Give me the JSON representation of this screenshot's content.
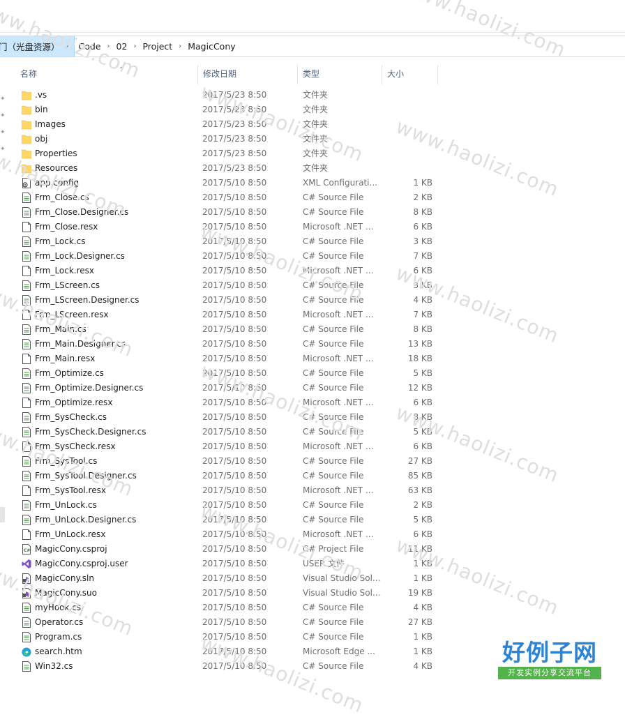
{
  "breadcrumb": [
    {
      "label": "门（光盘资源）"
    },
    {
      "label": "Code"
    },
    {
      "label": "02"
    },
    {
      "label": "Project"
    },
    {
      "label": "MagicCony"
    }
  ],
  "columns": {
    "name": "名称",
    "date": "修改日期",
    "type": "类型",
    "size": "大小"
  },
  "files": [
    {
      "name": ".vs",
      "date": "2017/5/23 8:50",
      "type": "文件夹",
      "size": "",
      "icon": "folder-icon"
    },
    {
      "name": "bin",
      "date": "2017/5/23 8:50",
      "type": "文件夹",
      "size": "",
      "icon": "folder-icon"
    },
    {
      "name": "Images",
      "date": "2017/5/23 8:50",
      "type": "文件夹",
      "size": "",
      "icon": "folder-icon"
    },
    {
      "name": "obj",
      "date": "2017/5/23 8:50",
      "type": "文件夹",
      "size": "",
      "icon": "folder-icon"
    },
    {
      "name": "Properties",
      "date": "2017/5/23 8:50",
      "type": "文件夹",
      "size": "",
      "icon": "folder-icon"
    },
    {
      "name": "Resources",
      "date": "2017/5/23 8:50",
      "type": "文件夹",
      "size": "",
      "icon": "folder-icon"
    },
    {
      "name": "app.config",
      "date": "2017/5/10 8:50",
      "type": "XML Configurati...",
      "size": "1 KB",
      "icon": "config-file-icon"
    },
    {
      "name": "Frm_Close.cs",
      "date": "2017/5/10 8:50",
      "type": "C# Source File",
      "size": "2 KB",
      "icon": "code-file-icon"
    },
    {
      "name": "Frm_Close.Designer.cs",
      "date": "2017/5/10 8:50",
      "type": "C# Source File",
      "size": "8 KB",
      "icon": "code-file-icon"
    },
    {
      "name": "Frm_Close.resx",
      "date": "2017/5/10 8:50",
      "type": "Microsoft .NET ...",
      "size": "6 KB",
      "icon": "blank-file-icon"
    },
    {
      "name": "Frm_Lock.cs",
      "date": "2017/5/10 8:50",
      "type": "C# Source File",
      "size": "3 KB",
      "icon": "code-file-icon"
    },
    {
      "name": "Frm_Lock.Designer.cs",
      "date": "2017/5/10 8:50",
      "type": "C# Source File",
      "size": "7 KB",
      "icon": "code-file-icon"
    },
    {
      "name": "Frm_Lock.resx",
      "date": "2017/5/10 8:50",
      "type": "Microsoft .NET ...",
      "size": "6 KB",
      "icon": "blank-file-icon"
    },
    {
      "name": "Frm_LScreen.cs",
      "date": "2017/5/10 8:50",
      "type": "C# Source File",
      "size": "3 KB",
      "icon": "code-file-icon"
    },
    {
      "name": "Frm_LScreen.Designer.cs",
      "date": "2017/5/10 8:50",
      "type": "C# Source File",
      "size": "4 KB",
      "icon": "code-file-icon"
    },
    {
      "name": "Frm_LScreen.resx",
      "date": "2017/5/10 8:50",
      "type": "Microsoft .NET ...",
      "size": "7 KB",
      "icon": "blank-file-icon"
    },
    {
      "name": "Frm_Main.cs",
      "date": "2017/5/10 8:50",
      "type": "C# Source File",
      "size": "8 KB",
      "icon": "code-file-icon"
    },
    {
      "name": "Frm_Main.Designer.cs",
      "date": "2017/5/10 8:50",
      "type": "C# Source File",
      "size": "13 KB",
      "icon": "code-file-icon"
    },
    {
      "name": "Frm_Main.resx",
      "date": "2017/5/10 8:50",
      "type": "Microsoft .NET ...",
      "size": "18 KB",
      "icon": "blank-file-icon"
    },
    {
      "name": "Frm_Optimize.cs",
      "date": "2017/5/10 8:50",
      "type": "C# Source File",
      "size": "5 KB",
      "icon": "code-file-icon"
    },
    {
      "name": "Frm_Optimize.Designer.cs",
      "date": "2017/5/10 8:50",
      "type": "C# Source File",
      "size": "12 KB",
      "icon": "code-file-icon"
    },
    {
      "name": "Frm_Optimize.resx",
      "date": "2017/5/10 8:50",
      "type": "Microsoft .NET ...",
      "size": "6 KB",
      "icon": "blank-file-icon"
    },
    {
      "name": "Frm_SysCheck.cs",
      "date": "2017/5/10 8:50",
      "type": "C# Source File",
      "size": "8 KB",
      "icon": "code-file-icon"
    },
    {
      "name": "Frm_SysCheck.Designer.cs",
      "date": "2017/5/10 8:50",
      "type": "C# Source File",
      "size": "5 KB",
      "icon": "code-file-icon"
    },
    {
      "name": "Frm_SysCheck.resx",
      "date": "2017/5/10 8:50",
      "type": "Microsoft .NET ...",
      "size": "6 KB",
      "icon": "blank-file-icon"
    },
    {
      "name": "Frm_SysTool.cs",
      "date": "2017/5/10 8:50",
      "type": "C# Source File",
      "size": "27 KB",
      "icon": "code-file-icon"
    },
    {
      "name": "Frm_SysTool.Designer.cs",
      "date": "2017/5/10 8:50",
      "type": "C# Source File",
      "size": "85 KB",
      "icon": "code-file-icon"
    },
    {
      "name": "Frm_SysTool.resx",
      "date": "2017/5/10 8:50",
      "type": "Microsoft .NET ...",
      "size": "63 KB",
      "icon": "blank-file-icon"
    },
    {
      "name": "Frm_UnLock.cs",
      "date": "2017/5/10 8:50",
      "type": "C# Source File",
      "size": "2 KB",
      "icon": "code-file-icon"
    },
    {
      "name": "Frm_UnLock.Designer.cs",
      "date": "2017/5/10 8:50",
      "type": "C# Source File",
      "size": "5 KB",
      "icon": "code-file-icon"
    },
    {
      "name": "Frm_UnLock.resx",
      "date": "2017/5/10 8:50",
      "type": "Microsoft .NET ...",
      "size": "6 KB",
      "icon": "blank-file-icon"
    },
    {
      "name": "MagicCony.csproj",
      "date": "2017/5/10 8:50",
      "type": "C# Project File",
      "size": "11 KB",
      "icon": "csproj-file-icon"
    },
    {
      "name": "MagicCony.csproj.user",
      "date": "2017/5/10 8:50",
      "type": "USER 文件",
      "size": "1 KB",
      "icon": "visual-studio-icon"
    },
    {
      "name": "MagicCony.sln",
      "date": "2017/5/10 8:50",
      "type": "Visual Studio Sol...",
      "size": "1 KB",
      "icon": "solution-file-icon"
    },
    {
      "name": "MagicCony.suo",
      "date": "2017/5/10 8:50",
      "type": "Visual Studio Sol...",
      "size": "19 KB",
      "icon": "solution-file-icon"
    },
    {
      "name": "myHook.cs",
      "date": "2017/5/10 8:50",
      "type": "C# Source File",
      "size": "4 KB",
      "icon": "code-file-icon"
    },
    {
      "name": "Operator.cs",
      "date": "2017/5/10 8:50",
      "type": "C# Source File",
      "size": "27 KB",
      "icon": "code-file-icon"
    },
    {
      "name": "Program.cs",
      "date": "2017/5/10 8:50",
      "type": "C# Source File",
      "size": "1 KB",
      "icon": "code-file-icon"
    },
    {
      "name": "search.htm",
      "date": "2017/5/10 8:50",
      "type": "Microsoft Edge ...",
      "size": "1 KB",
      "icon": "edge-icon"
    },
    {
      "name": "Win32.cs",
      "date": "2017/5/10 8:50",
      "type": "C# Source File",
      "size": "4 KB",
      "icon": "code-file-icon"
    }
  ],
  "watermark": {
    "text": "www.haolizi.com"
  },
  "logo": {
    "main": "好例子网",
    "sub": "开发实例分享交流平台"
  },
  "colors": {
    "folder": "#ffd767",
    "selection": "#cce8ff",
    "header_text": "#4c607a",
    "meta_text": "#6d6d6d",
    "logo_blue": "#2b84d6",
    "logo_green": "#54b24b"
  }
}
